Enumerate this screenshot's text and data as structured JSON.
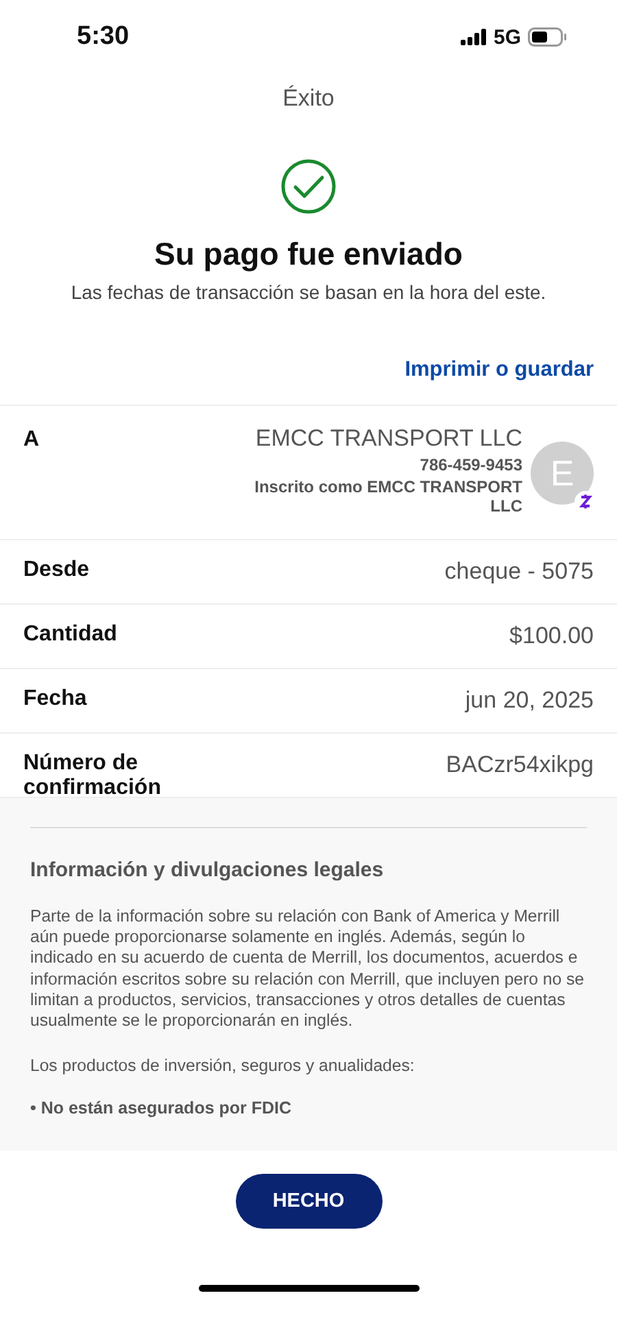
{
  "status_bar": {
    "time": "5:30",
    "network": "5G"
  },
  "nav": {
    "title": "Éxito"
  },
  "header": {
    "heading": "Su pago fue enviado",
    "subtitle": "Las fechas de transacción se basan en la hora del este."
  },
  "print_link": "Imprimir o guardar",
  "recipient": {
    "label": "A",
    "name": "EMCC TRANSPORT LLC",
    "phone": "786-459-9453",
    "enrolled": "Inscrito como EMCC TRANSPORT LLC",
    "avatar_letter": "E"
  },
  "details": [
    {
      "label": "Desde",
      "value": "cheque - 5075"
    },
    {
      "label": "Cantidad",
      "value": "$100.00"
    },
    {
      "label": "Fecha",
      "value": "jun 20, 2025"
    },
    {
      "label": "Número de confirmación",
      "value": "BACzr54xikpg"
    }
  ],
  "legal": {
    "title": "Información y divulgaciones legales",
    "paragraphs": [
      "Parte de la información sobre su relación con Bank of America y Merrill aún puede proporcionarse solamente en inglés. Además, según lo indicado en su acuerdo de cuenta de Merrill, los documentos, acuerdos e información escritos sobre su relación con Merrill, que incluyen pero no se limitan a productos, servicios, transacciones y otros detalles de cuentas usualmente se le proporcionarán en inglés.",
      "Los productos de inversión, seguros y anualidades:"
    ],
    "bullet": "• No están asegurados por FDIC"
  },
  "done_button": "HECHO"
}
